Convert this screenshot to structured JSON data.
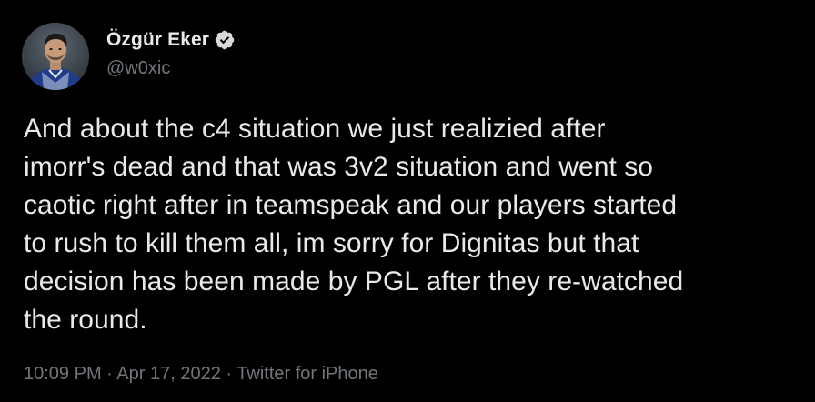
{
  "tweet": {
    "author": {
      "display_name": "Özgür Eker",
      "handle": "@w0xic",
      "verified": true,
      "verified_icon": "verified-badge-icon",
      "avatar_icon": "avatar-photo"
    },
    "text": "And about the c4 situation we just realizied after\nimorr's dead and that was 3v2 situation and went so\ncaotic right after in teamspeak and our players started\nto rush to kill them all, im sorry for Dignitas but that\ndecision has been made by PGL after they re-watched\nthe round.",
    "time": "10:09 PM",
    "separator_1": "·",
    "date": "Apr 17, 2022",
    "separator_2": "·",
    "source": "Twitter for iPhone"
  },
  "colors": {
    "background": "#000000",
    "primary_text": "#e7e9ea",
    "secondary_text": "#71767b",
    "verified_badge": "#d9d9d9"
  }
}
